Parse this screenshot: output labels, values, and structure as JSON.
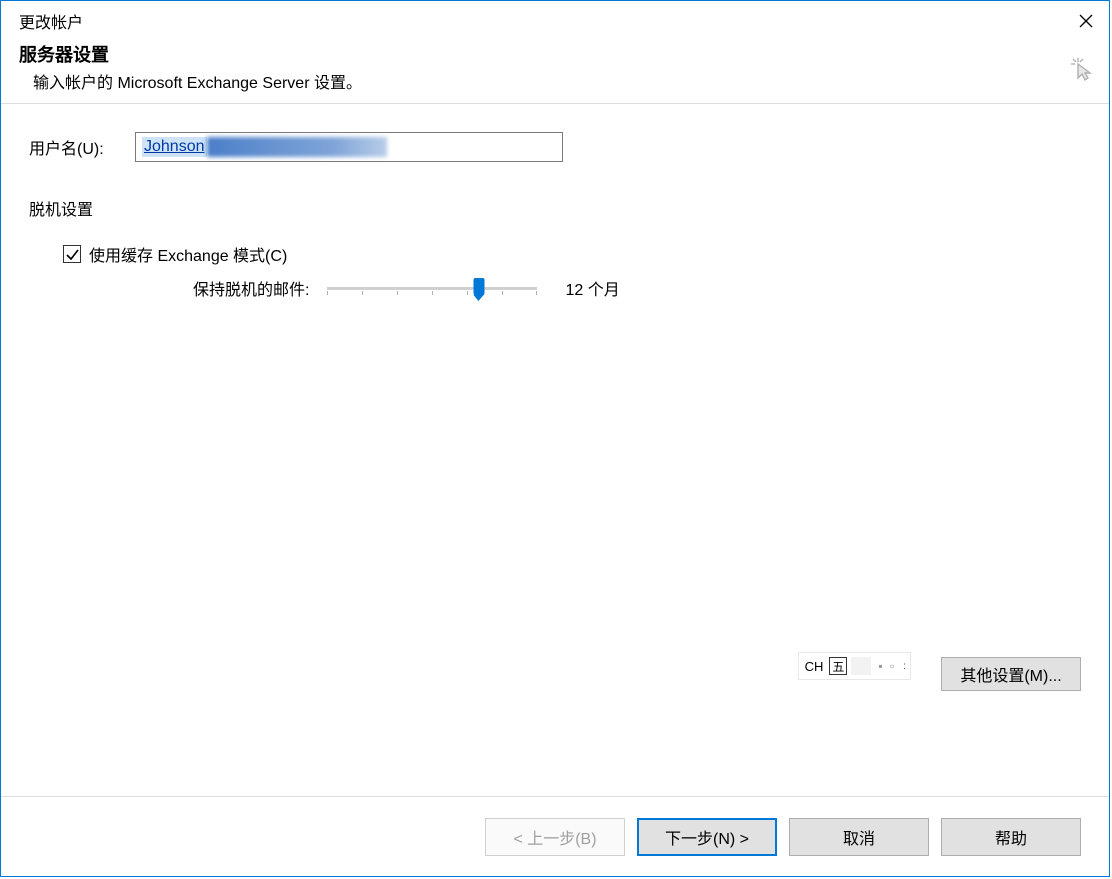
{
  "titlebar": {
    "title": "更改帐户"
  },
  "header": {
    "title": "服务器设置",
    "subtitle": "输入帐户的 Microsoft Exchange Server 设置。"
  },
  "form": {
    "username_label": "用户名(U):",
    "username_value": "Johnson"
  },
  "offline": {
    "section_label": "脱机设置",
    "cache_checkbox_label": "使用缓存 Exchange 模式(C)",
    "cache_checked": true,
    "slider_label": "保持脱机的邮件:",
    "slider_value_text": "12 个月",
    "slider_position_percent": 72
  },
  "ime": {
    "lang": "CH",
    "mode": "五"
  },
  "buttons": {
    "more_settings": "其他设置(M)...",
    "back": "< 上一步(B)",
    "next": "下一步(N) >",
    "cancel": "取消",
    "help": "帮助"
  }
}
